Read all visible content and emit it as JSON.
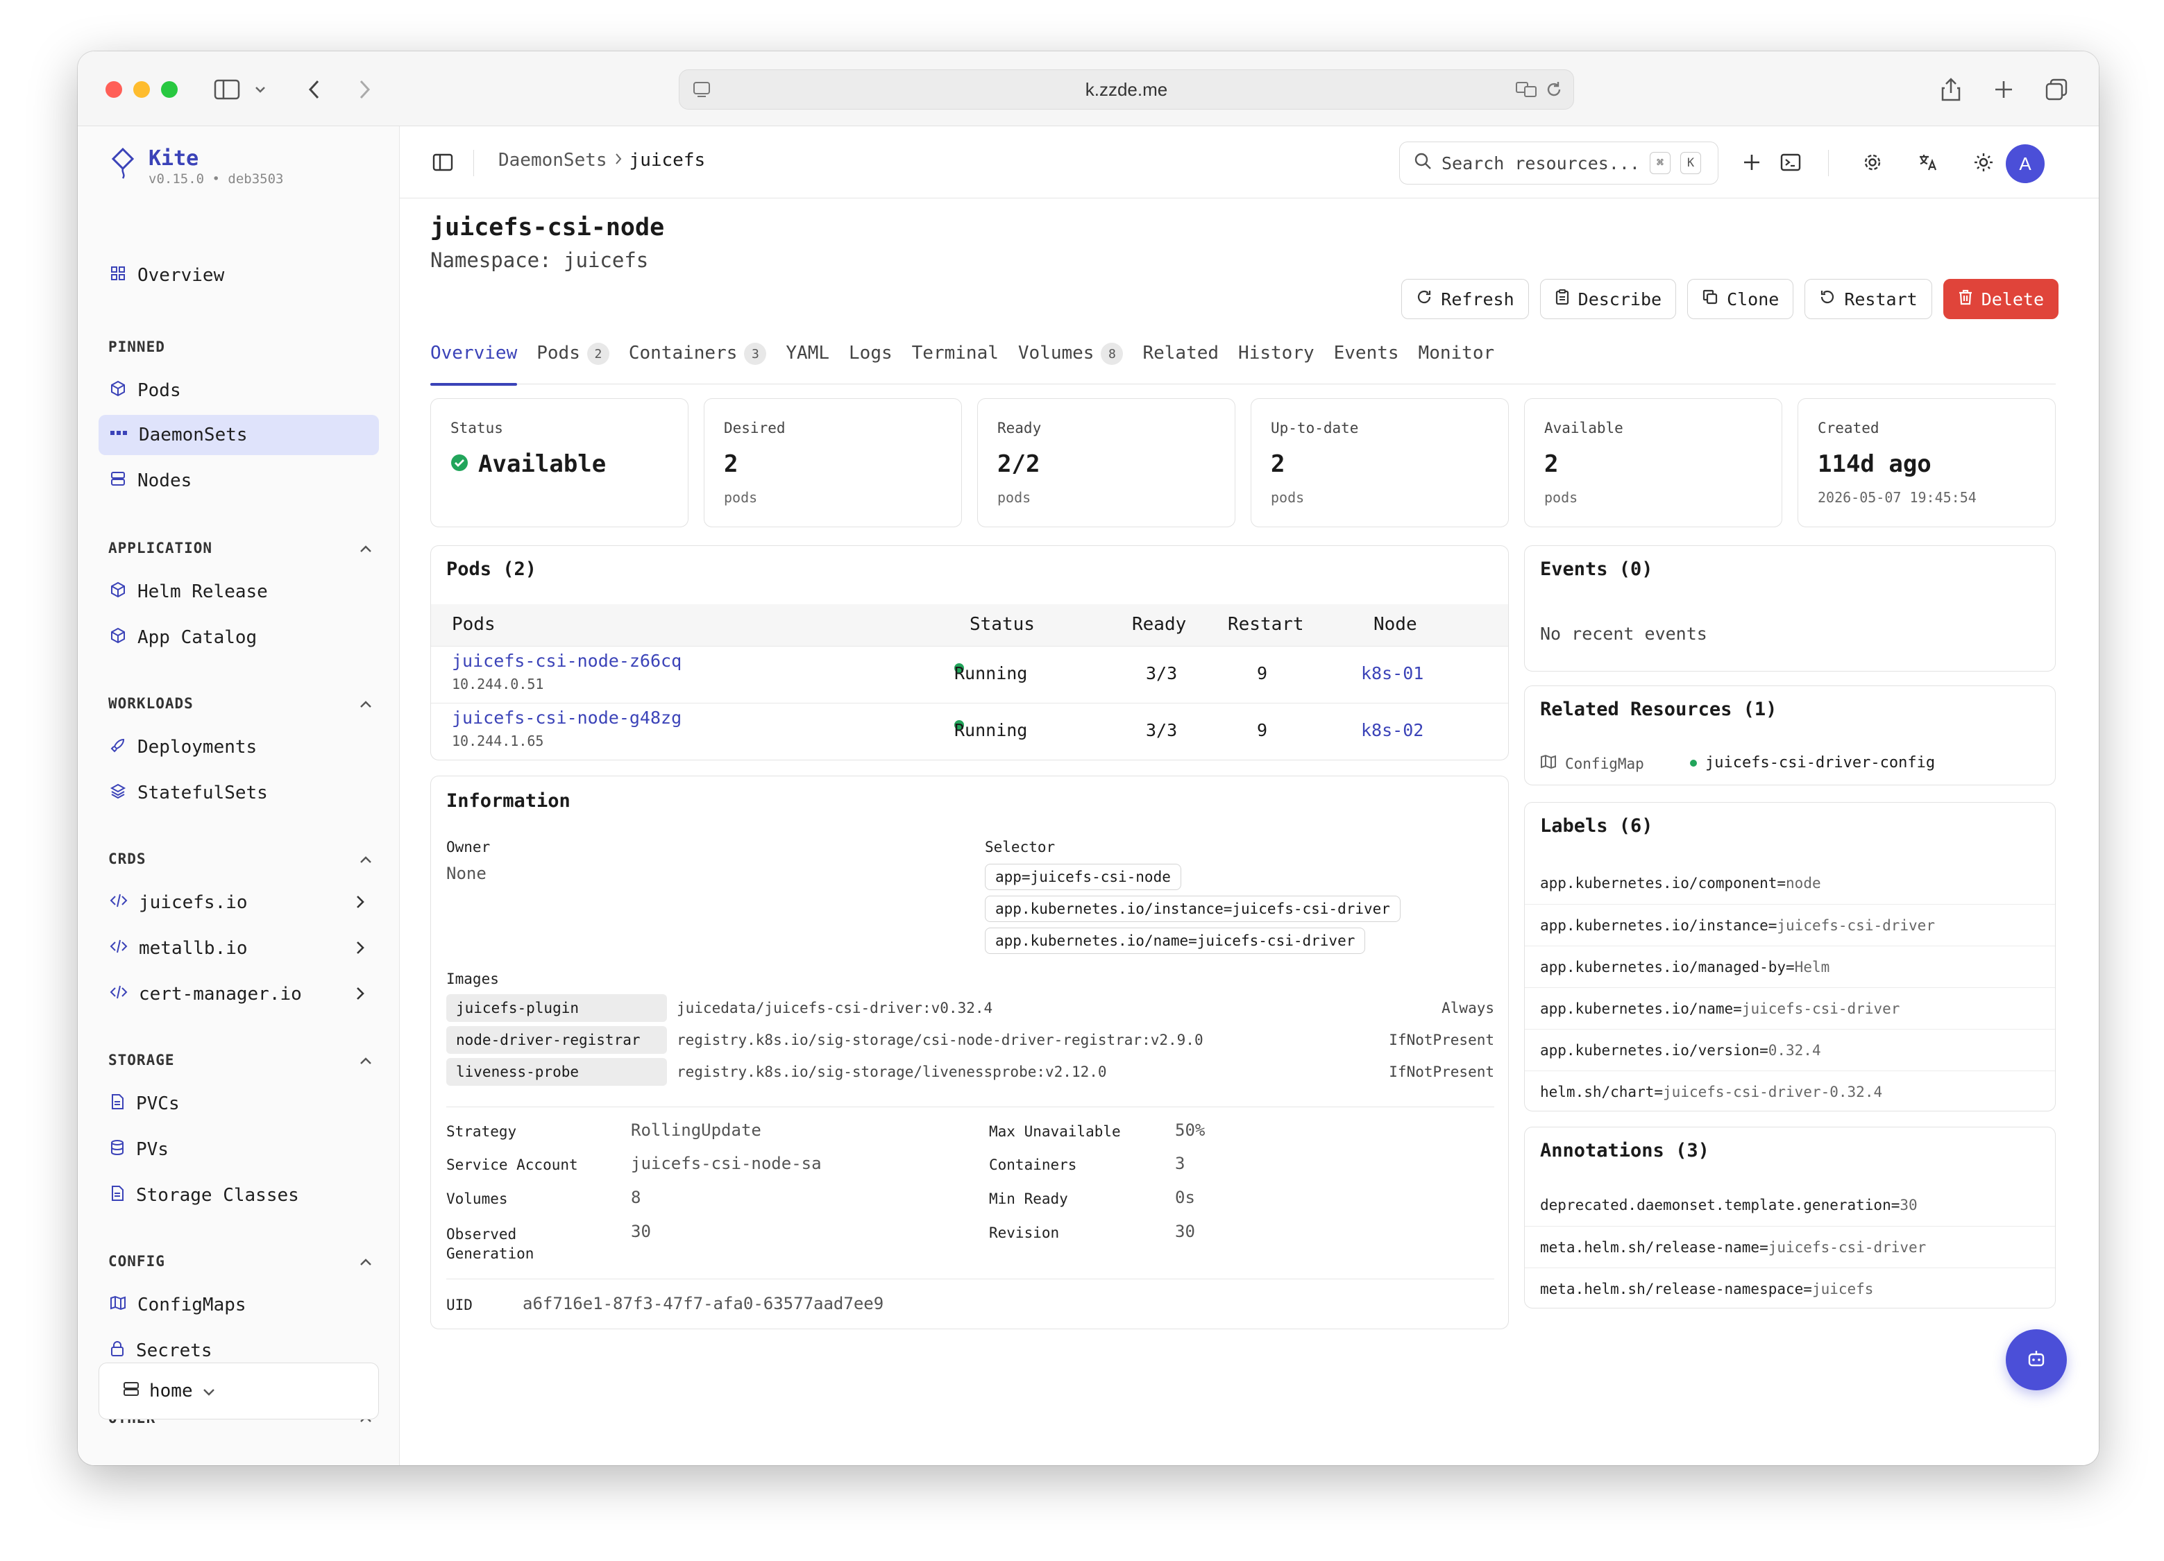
{
  "browser": {
    "url": "k.zzde.me"
  },
  "sidebar": {
    "brand": {
      "name": "Kite",
      "version": "v0.15.0 • deb3503"
    },
    "overview": "Overview",
    "pinned": {
      "title": "PINNED",
      "items": [
        "Pods",
        "DaemonSets",
        "Nodes"
      ]
    },
    "application": {
      "title": "APPLICATION",
      "items": [
        "Helm Release",
        "App Catalog"
      ]
    },
    "workloads": {
      "title": "WORKLOADS",
      "items": [
        "Deployments",
        "StatefulSets"
      ]
    },
    "crds": {
      "title": "CRDS",
      "items": [
        "juicefs.io",
        "metallb.io",
        "cert-manager.io"
      ]
    },
    "storage": {
      "title": "STORAGE",
      "items": [
        "PVCs",
        "PVs",
        "Storage Classes"
      ]
    },
    "config": {
      "title": "CONFIG",
      "items": [
        "ConfigMaps",
        "Secrets"
      ]
    },
    "other": {
      "title": "OTHER"
    },
    "cluster": "home"
  },
  "topbar": {
    "breadcrumb": [
      "DaemonSets",
      "juicefs"
    ],
    "search_placeholder": "Search resources...",
    "kbd": [
      "⌘",
      "K"
    ],
    "avatar": "A"
  },
  "resource": {
    "name": "juicefs-csi-node",
    "namespace": "Namespace: juicefs"
  },
  "actions": [
    "Refresh",
    "Describe",
    "Clone",
    "Restart",
    "Delete"
  ],
  "tabs": [
    {
      "label": "Overview",
      "badge": ""
    },
    {
      "label": "Pods",
      "badge": "2"
    },
    {
      "label": "Containers",
      "badge": "3"
    },
    {
      "label": "YAML",
      "badge": ""
    },
    {
      "label": "Logs",
      "badge": ""
    },
    {
      "label": "Terminal",
      "badge": ""
    },
    {
      "label": "Volumes",
      "badge": "8"
    },
    {
      "label": "Related",
      "badge": ""
    },
    {
      "label": "History",
      "badge": ""
    },
    {
      "label": "Events",
      "badge": ""
    },
    {
      "label": "Monitor",
      "badge": ""
    }
  ],
  "stats": [
    {
      "label": "Status",
      "value": "Available",
      "sub": ""
    },
    {
      "label": "Desired",
      "value": "2",
      "sub": "pods"
    },
    {
      "label": "Ready",
      "value": "2/2",
      "sub": "pods"
    },
    {
      "label": "Up-to-date",
      "value": "2",
      "sub": "pods"
    },
    {
      "label": "Available",
      "value": "2",
      "sub": "pods"
    },
    {
      "label": "Created",
      "value": "114d ago",
      "sub": "2026-05-07 19:45:54"
    }
  ],
  "pods": {
    "title": "Pods (2)",
    "columns": [
      "Pods",
      "Status",
      "Ready",
      "Restart",
      "Node"
    ],
    "rows": [
      {
        "name": "juicefs-csi-node-z66cq",
        "ip": "10.244.0.51",
        "status": "Running",
        "ready": "3/3",
        "restart": "9",
        "node": "k8s-01"
      },
      {
        "name": "juicefs-csi-node-g48zg",
        "ip": "10.244.1.65",
        "status": "Running",
        "ready": "3/3",
        "restart": "9",
        "node": "k8s-02"
      }
    ]
  },
  "information": {
    "title": "Information",
    "owner_label": "Owner",
    "owner": "None",
    "selector_label": "Selector",
    "selectors": [
      "app=juicefs-csi-node",
      "app.kubernetes.io/instance=juicefs-csi-driver",
      "app.kubernetes.io/name=juicefs-csi-driver"
    ],
    "images_label": "Images",
    "images": [
      {
        "name": "juicefs-plugin",
        "image": "juicedata/juicefs-csi-driver:v0.32.4",
        "policy": "Always"
      },
      {
        "name": "node-driver-registrar",
        "image": "registry.k8s.io/sig-storage/csi-node-driver-registrar:v2.9.0",
        "policy": "IfNotPresent"
      },
      {
        "name": "liveness-probe",
        "image": "registry.k8s.io/sig-storage/livenessprobe:v2.12.0",
        "policy": "IfNotPresent"
      }
    ],
    "left": [
      {
        "k": "Strategy",
        "v": "RollingUpdate"
      },
      {
        "k": "Service Account",
        "v": "juicefs-csi-node-sa"
      },
      {
        "k": "Volumes",
        "v": "8"
      },
      {
        "k": "Observed\nGeneration",
        "v": "30"
      }
    ],
    "right": [
      {
        "k": "Max Unavailable",
        "v": "50%"
      },
      {
        "k": "Containers",
        "v": "3"
      },
      {
        "k": "Min Ready",
        "v": "0s"
      },
      {
        "k": "Revision",
        "v": "30"
      }
    ],
    "uid_label": "UID",
    "uid": "a6f716e1-87f3-47f7-afa0-63577aad7ee9"
  },
  "events": {
    "title": "Events (0)",
    "empty": "No recent events"
  },
  "related": {
    "title": "Related Resources (1)",
    "kind": "ConfigMap",
    "name": "juicefs-csi-driver-config"
  },
  "labels": {
    "title": "Labels (6)",
    "items": [
      {
        "k": "app.kubernetes.io/component",
        "v": "node"
      },
      {
        "k": "app.kubernetes.io/instance",
        "v": "juicefs-csi-driver"
      },
      {
        "k": "app.kubernetes.io/managed-by",
        "v": "Helm"
      },
      {
        "k": "app.kubernetes.io/name",
        "v": "juicefs-csi-driver"
      },
      {
        "k": "app.kubernetes.io/version",
        "v": "0.32.4"
      },
      {
        "k": "helm.sh/chart",
        "v": "juicefs-csi-driver-0.32.4"
      }
    ]
  },
  "annotations": {
    "title": "Annotations (3)",
    "items": [
      {
        "k": "deprecated.daemonset.template.generation",
        "v": "30"
      },
      {
        "k": "meta.helm.sh/release-name",
        "v": "juicefs-csi-driver"
      },
      {
        "k": "meta.helm.sh/release-namespace",
        "v": "juicefs"
      }
    ]
  },
  "colors": {
    "accent": "#3b43b8",
    "danger": "#e0443a",
    "success": "#22a55b"
  }
}
